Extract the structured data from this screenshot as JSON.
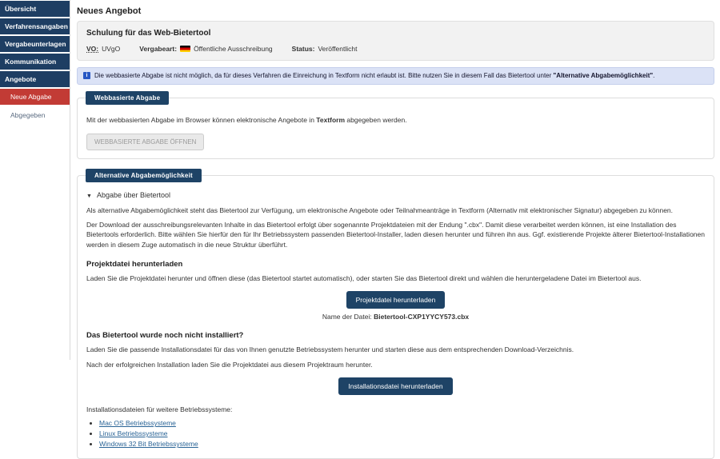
{
  "sidebar": {
    "items": [
      {
        "label": "Übersicht"
      },
      {
        "label": "Verfahrensangaben"
      },
      {
        "label": "Vergabeunterlagen"
      },
      {
        "label": "Kommunikation"
      },
      {
        "label": "Angebote"
      }
    ],
    "sub_items": [
      {
        "label": "Neue Abgabe",
        "active": true
      },
      {
        "label": "Abgegeben",
        "active": false
      }
    ]
  },
  "header": {
    "title": "Neues Angebot"
  },
  "procedure": {
    "title": "Schulung für das Web-Bietertool",
    "vo_label": "VO:",
    "vo_value": "UVgO",
    "vergabeart_label": "Vergabeart:",
    "vergabeart_value": "Öffentliche Ausschreibung",
    "flag_icon": "german-flag-icon",
    "status_label": "Status:",
    "status_value": "Veröffentlicht"
  },
  "info_banner": {
    "icon": "info-icon",
    "text_prefix": "Die webbasierte Abgabe ist nicht möglich, da für dieses Verfahren die Einreichung in Textform nicht erlaubt ist. Bitte nutzen Sie in diesem Fall das Bietertool unter ",
    "text_bold": "\"Alternative Abgabemöglichkeit\"",
    "text_suffix": "."
  },
  "web_submission": {
    "badge": "Webbasierte Abgabe",
    "text_prefix": "Mit der webbasierten Abgabe im Browser können elektronische Angebote in ",
    "text_bold": "Textform",
    "text_suffix": " abgegeben werden.",
    "button_label": "WEBBASIERTE ABGABE ÖFFNEN"
  },
  "alternative": {
    "badge": "Alternative Abgabemöglichkeit",
    "collapse_icon": "▼",
    "collapse_label": "Abgabe über Bietertool",
    "paragraph1": "Als alternative Abgabemöglichkeit steht das Bietertool zur Verfügung, um elektronische Angebote oder Teilnahmeanträge in Textform (Alternativ mit elektronischer Signatur) abgegeben zu können.",
    "paragraph2": "Der Download der ausschreibungsrelevanten Inhalte in das Bietertool erfolgt über sogenannte Projektdateien mit der Endung \".cbx\". Damit diese verarbeitet werden können, ist eine Installation des Bietertools erforderlich. Bitte wählen Sie hierfür den für Ihr Betriebssystem passenden Bietertool-Installer, laden diesen herunter und führen ihn aus. Ggf. existierende Projekte älterer Bietertool-Installationen werden in diesem Zuge automatisch in die neue Struktur überführt.",
    "project_file": {
      "heading": "Projektdatei herunterladen",
      "text": "Laden Sie die Projektdatei herunter und öffnen diese (das Bietertool startet automatisch), oder starten Sie das Bietertool direkt und wählen die heruntergeladene Datei im Bietertool aus.",
      "button_label": "Projektdatei herunterladen",
      "file_label": "Name der Datei: ",
      "file_name": "Bietertool-CXP1YYCY573.cbx"
    },
    "install": {
      "heading": "Das Bietertool wurde noch nicht installiert?",
      "text1": "Laden Sie die passende Installationsdatei für das von Ihnen genutzte Betriebssystem herunter und starten diese aus dem entsprechenden Download-Verzeichnis.",
      "text2": "Nach der erfolgreichen Installation laden Sie die Projektdatei aus diesem Projektraum herunter.",
      "button_label": "Installationsdatei herunterladen",
      "other_os_label": "Installationsdateien für weitere Betriebssysteme:",
      "links": [
        {
          "label": "Mac OS Betriebssysteme"
        },
        {
          "label": "Linux Betriebssysteme"
        },
        {
          "label": "Windows 32 Bit Betriebssysteme"
        }
      ]
    }
  },
  "colors": {
    "navy": "#1e4366",
    "sidebar_navy": "#1e3e63",
    "active_red": "#c23b35",
    "info_bg": "#dbe2f6",
    "link_blue": "#2a6496"
  }
}
